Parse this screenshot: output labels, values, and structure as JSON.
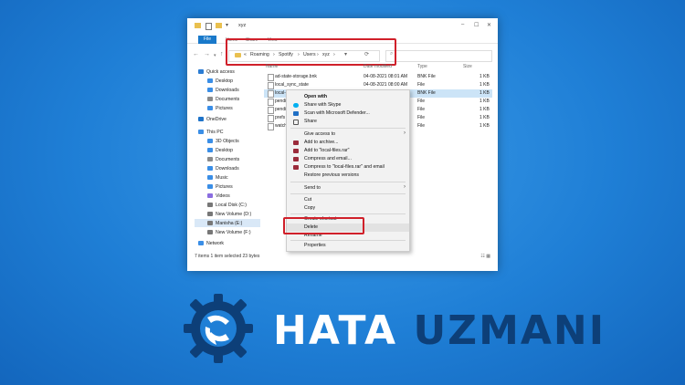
{
  "window": {
    "title": "xyz",
    "ribbon_tabs": [
      "File",
      "Home",
      "Share",
      "View"
    ],
    "breadcrumb": [
      "Roaming",
      "Spotify",
      "Users",
      "xyz"
    ],
    "breadcrumb_prefix": "«",
    "sep": "›"
  },
  "sidebar": {
    "items": [
      {
        "label": "Quick access",
        "icon": "star-icon",
        "color": "#2b7cd3"
      },
      {
        "label": "Desktop",
        "icon": "desktop-icon",
        "color": "#3a8ee6"
      },
      {
        "label": "Downloads",
        "icon": "download-icon",
        "color": "#3a8ee6"
      },
      {
        "label": "Documents",
        "icon": "documents-icon",
        "color": "#8a8a8a"
      },
      {
        "label": "Pictures",
        "icon": "pictures-icon",
        "color": "#3a8ee6"
      },
      {
        "label": "OneDrive",
        "icon": "cloud-icon",
        "color": "#1e73c9"
      },
      {
        "label": "This PC",
        "icon": "computer-icon",
        "color": "#3a8ee6"
      },
      {
        "label": "3D Objects",
        "icon": "cube-icon",
        "color": "#3a8ee6"
      },
      {
        "label": "Desktop",
        "icon": "desktop-icon",
        "color": "#3a8ee6"
      },
      {
        "label": "Documents",
        "icon": "documents-icon",
        "color": "#8a8a8a"
      },
      {
        "label": "Downloads",
        "icon": "download-icon",
        "color": "#3a8ee6"
      },
      {
        "label": "Music",
        "icon": "music-icon",
        "color": "#3a8ee6"
      },
      {
        "label": "Pictures",
        "icon": "pictures-icon",
        "color": "#3a8ee6"
      },
      {
        "label": "Videos",
        "icon": "video-icon",
        "color": "#8a6de0"
      },
      {
        "label": "Local Disk (C:)",
        "icon": "drive-icon",
        "color": "#777777"
      },
      {
        "label": "New Volume (D:)",
        "icon": "drive-icon",
        "color": "#777777"
      },
      {
        "label": "Manisha (E:)",
        "icon": "drive-icon",
        "color": "#777777"
      },
      {
        "label": "New Volume (F:)",
        "icon": "drive-icon",
        "color": "#777777"
      },
      {
        "label": "Network",
        "icon": "network-icon",
        "color": "#3a8ee6"
      }
    ]
  },
  "columns": {
    "name": "Name",
    "date": "Date modified",
    "type": "Type",
    "size": "Size"
  },
  "files": [
    {
      "name": "ad-state-storage.bnk",
      "date": "04-08-2021 08:01 AM",
      "type": "BNK File",
      "size": "1 KB"
    },
    {
      "name": "local_sync_state",
      "date": "04-08-2021 08:00 AM",
      "type": "File",
      "size": "1 KB"
    },
    {
      "name": "local-files",
      "date": "",
      "type": "BNK File",
      "size": "1 KB"
    },
    {
      "name": "pending",
      "date": "",
      "type": "File",
      "size": "1 KB"
    },
    {
      "name": "pending",
      "date": "",
      "type": "File",
      "size": "1 KB"
    },
    {
      "name": "prefs",
      "date": "",
      "type": "File",
      "size": "1 KB"
    },
    {
      "name": "watch-s",
      "date": "",
      "type": "File",
      "size": "1 KB"
    }
  ],
  "status": "7 items    1 item selected  23 bytes",
  "context_menu": {
    "items": [
      {
        "label": "Open with",
        "bold": true
      },
      {
        "label": "Share with Skype",
        "icon": "skype-icon"
      },
      {
        "label": "Scan with Microsoft Defender...",
        "icon": "defender-icon"
      },
      {
        "label": "Share",
        "icon": "share-icon"
      },
      {
        "sep": true
      },
      {
        "label": "Give access to",
        "arrow": true
      },
      {
        "label": "Add to archive...",
        "icon": "winrar-icon"
      },
      {
        "label": "Add to \"local-files.rar\"",
        "icon": "winrar-icon"
      },
      {
        "label": "Compress and email...",
        "icon": "winrar-icon"
      },
      {
        "label": "Compress to \"local-files.rar\" and email",
        "icon": "winrar-icon"
      },
      {
        "label": "Restore previous versions"
      },
      {
        "sep": true
      },
      {
        "label": "Send to",
        "arrow": true
      },
      {
        "sep": true
      },
      {
        "label": "Cut"
      },
      {
        "label": "Copy"
      },
      {
        "sep": true
      },
      {
        "label": "Create shortcut"
      },
      {
        "label": "Delete"
      },
      {
        "label": "Rename"
      },
      {
        "sep": true
      },
      {
        "label": "Properties"
      }
    ]
  },
  "brand": {
    "part1": "HATA",
    "part2": "UZMANI"
  },
  "colors": {
    "accent": "#1979ca",
    "highlight": "#d0202a",
    "brand_dark": "#0d3f78"
  }
}
